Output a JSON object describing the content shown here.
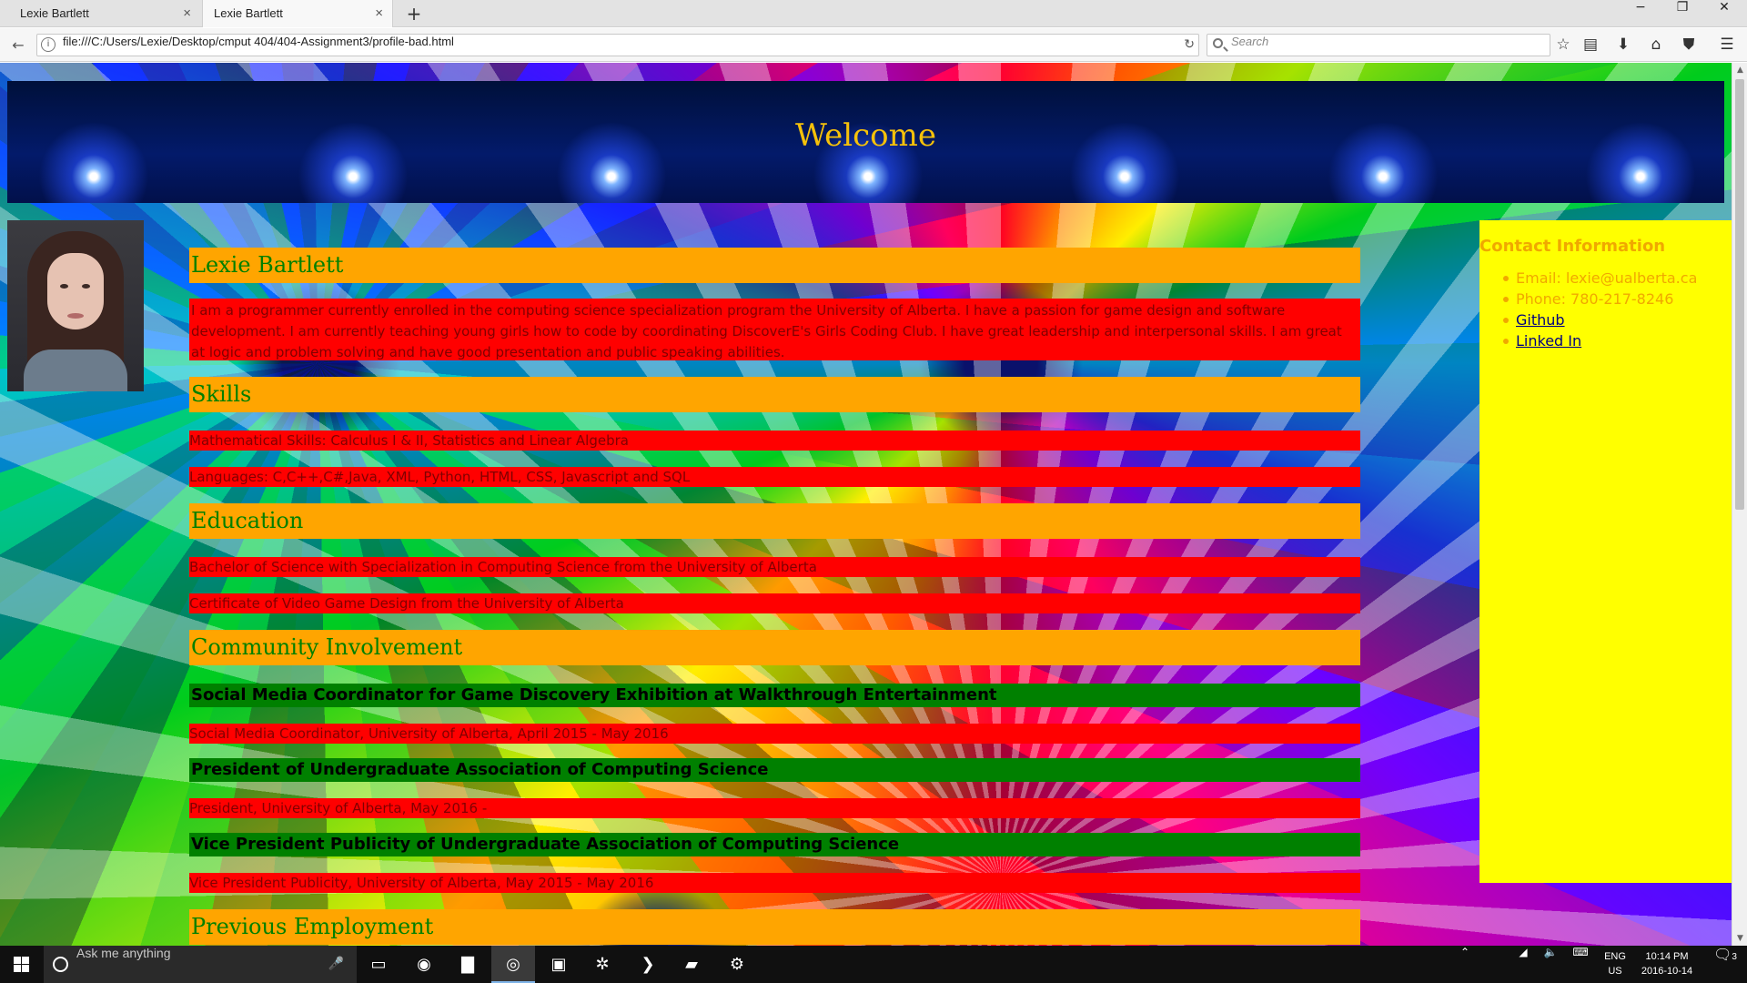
{
  "tabs": [
    {
      "title": "Lexie Bartlett",
      "close": "×"
    },
    {
      "title": "Lexie Bartlett",
      "close": "×"
    }
  ],
  "new_tab": "+",
  "window_controls": {
    "minimize": "−",
    "maximize": "❐",
    "close": "✕"
  },
  "nav": {
    "back_icon": "←",
    "url": "file:///C:/Users/Lexie/Desktop/cmput 404/404-Assignment3/profile-bad.html",
    "reload_icon": "↻",
    "search_placeholder": "Search",
    "toolbar_icons": [
      "☆",
      "▤",
      "⬇",
      "⌂",
      "⛊",
      "☰"
    ]
  },
  "page": {
    "banner_title": "Welcome",
    "name_heading": "Lexie Bartlett",
    "bio": "I am a programmer currently enrolled in the computing science specialization program the University of Alberta. I have a passion for game design and software development. I am currently teaching young girls how to code by coordinating DiscoverE's Girls Coding Club. I have great leadership and interpersonal skills. I am great at logic and problem solving and have good presentation and public speaking abilities.",
    "skills_heading": "Skills",
    "skills": [
      "Mathematical Skills: Calculus I & II, Statistics and Linear Algebra",
      "Languages: C,C++,C#,Java, XML, Python, HTML, CSS, Javascript and SQL"
    ],
    "education_heading": "Education",
    "education": [
      "Bachelor of Science with Specialization in Computing Science from the University of Alberta",
      "Certificate of Video Game Design from the University of Alberta"
    ],
    "community_heading": "Community Involvement",
    "community": [
      {
        "title": "Social Media Coordinator for Game Discovery Exhibition at Walkthrough Entertainment",
        "detail": "Social Media Coordinator, University of Alberta, April 2015 - May 2016"
      },
      {
        "title": "President of Undergraduate Association of Computing Science",
        "detail": "President, University of Alberta, May 2016 -"
      },
      {
        "title": "Vice President Publicity of Undergraduate Association of Computing Science",
        "detail": "Vice President Publicity, University of Alberta, May 2015 - May 2016"
      }
    ],
    "next_heading_partial": "Previous Employment"
  },
  "contact": {
    "title": "Contact Information",
    "email": "Email: lexie@ualberta.ca",
    "phone": "Phone: 780-217-8246",
    "github": "Github",
    "linkedin": "Linked In"
  },
  "taskbar": {
    "search_text": "Ask me anything",
    "mic_icon": "🎤",
    "apps": [
      "▭",
      "◉",
      "▇",
      "◎",
      "▣",
      "✲",
      "❯",
      "▰",
      "⚙"
    ],
    "tray_icons": [
      "⌃",
      "◢",
      "🔈",
      "⌨"
    ],
    "lang_top": "ENG",
    "lang_bottom": "US",
    "time": "10:14 PM",
    "date": "2016-10-14",
    "notifications": "3"
  },
  "colors": {
    "heading_bg": "#ffa500",
    "paragraph_bg": "#ff0000",
    "job_title_bg": "#008000",
    "contact_bg": "#ffff00",
    "welcome_text": "#f5c10a"
  }
}
